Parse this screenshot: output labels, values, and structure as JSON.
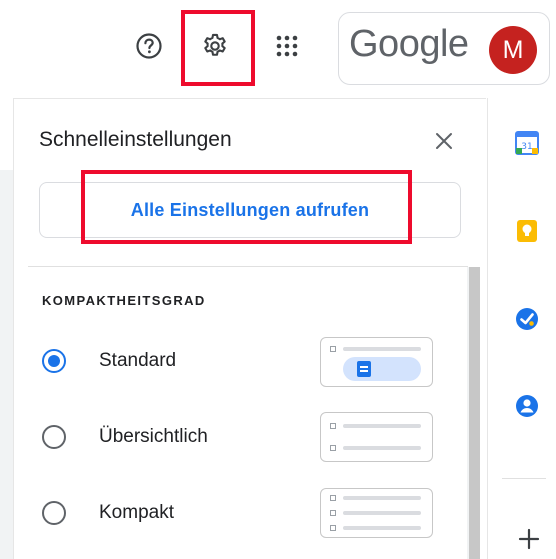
{
  "topbar": {
    "brand_text": "Google",
    "avatar_letter": "M",
    "avatar_color": "#c5221f",
    "icons": [
      "help-icon",
      "gear-icon",
      "apps-grid-icon"
    ]
  },
  "panel": {
    "title": "Schnelleinstellungen",
    "all_settings_label": "Alle Einstellungen aufrufen",
    "section_density": "KOMPAKTHEITSGRAD",
    "options": [
      {
        "label": "Standard",
        "selected": true
      },
      {
        "label": "Übersichtlich",
        "selected": false
      },
      {
        "label": "Kompakt",
        "selected": false
      }
    ]
  },
  "side_apps": [
    "calendar-icon",
    "keep-icon",
    "tasks-icon",
    "contacts-icon",
    "add-icon"
  ],
  "colors": {
    "accent": "#1a73e8",
    "highlight": "#ee0b2d"
  }
}
